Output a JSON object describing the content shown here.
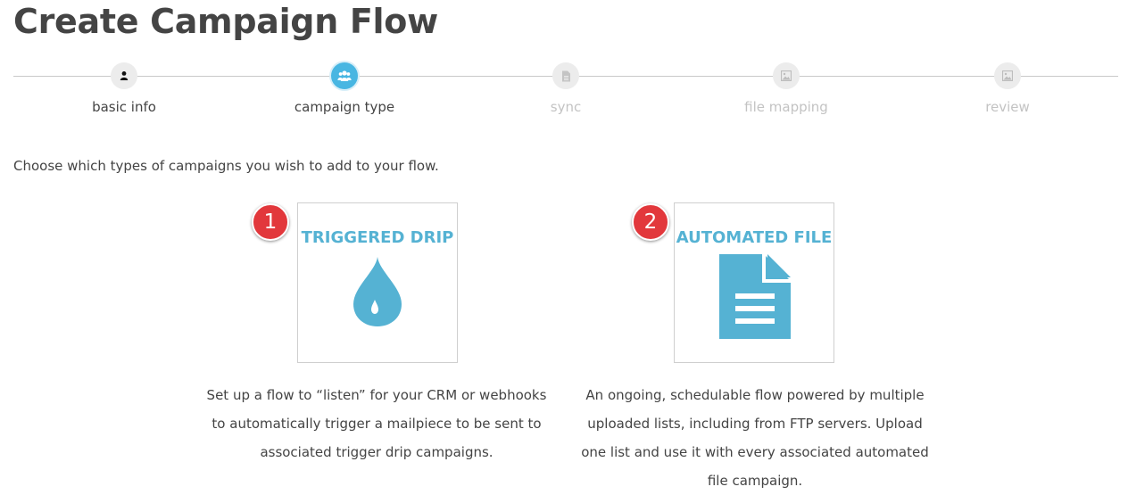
{
  "page": {
    "title": "Create Campaign Flow"
  },
  "stepper": {
    "steps": [
      {
        "label": "basic info",
        "icon": "person-icon",
        "state": "done"
      },
      {
        "label": "campaign type",
        "icon": "users-icon",
        "state": "active"
      },
      {
        "label": "sync",
        "icon": "document-icon",
        "state": "pending"
      },
      {
        "label": "file mapping",
        "icon": "image-icon",
        "state": "pending"
      },
      {
        "label": "review",
        "icon": "image-icon",
        "state": "pending"
      }
    ]
  },
  "intro": "Choose which types of campaigns you wish to add to your flow.",
  "options": [
    {
      "badge": "1",
      "title": "TRIGGERED DRIP",
      "icon": "water-drop-icon",
      "description": "Set up a flow to “listen” for your CRM or webhooks to automatically trigger a mailpiece to be sent to associated trigger drip campaigns."
    },
    {
      "badge": "2",
      "title": "AUTOMATED FILE",
      "icon": "file-document-icon",
      "description": "An ongoing, schedulable flow powered by multiple uploaded lists, including from FTP servers. Upload one list and use it with every associated automated file campaign."
    }
  ],
  "colors": {
    "accent": "#55b2d3",
    "active_step": "#48b6e2",
    "badge": "#e2383c",
    "inactive_text": "#c3c3c3",
    "text": "#444444"
  }
}
